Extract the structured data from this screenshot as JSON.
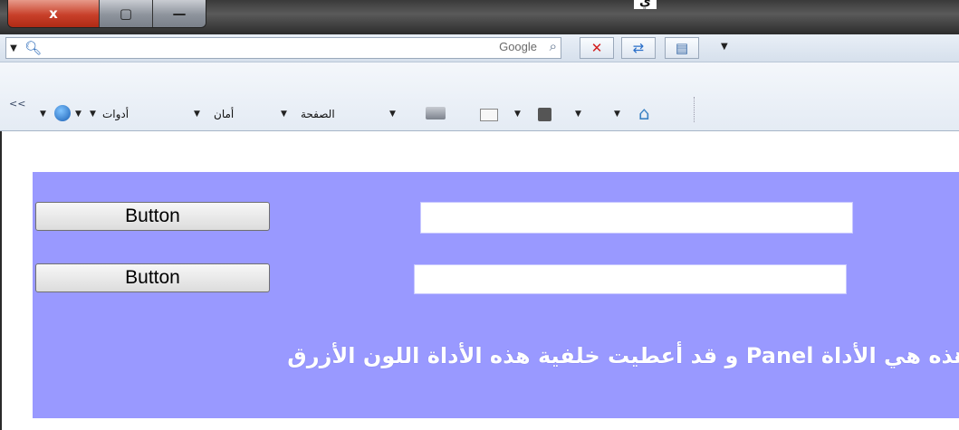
{
  "window": {
    "title_fragment": "ي",
    "caption": {
      "close": "x",
      "restore": "▢",
      "minimize": "—"
    }
  },
  "search": {
    "placeholder": "Google",
    "drop_arrow": "▼"
  },
  "command_bar": {
    "overflow": "<<",
    "tools_label": "أدوات",
    "safety_label": "أمان",
    "page_label": "الصفحة",
    "drop_arrow": "▼"
  },
  "panel": {
    "button1_label": "Button",
    "button2_label": "Button",
    "textbox1_value": "",
    "textbox2_value": "",
    "text_prefix": "هذه هي الأداة ",
    "text_keyword": "Panel",
    "text_suffix": " و قد أعطيت خلفية هذه الأداة اللون الأزرق",
    "background_color": "#9999ff"
  },
  "colors": {
    "panel": "#9999ff",
    "close_button": "#c8402a"
  },
  "icons": [
    "search-icon",
    "stop-icon",
    "refresh-icon",
    "compatibility-icon",
    "home-icon",
    "feeds-icon",
    "mail-icon",
    "print-icon",
    "help-icon"
  ]
}
